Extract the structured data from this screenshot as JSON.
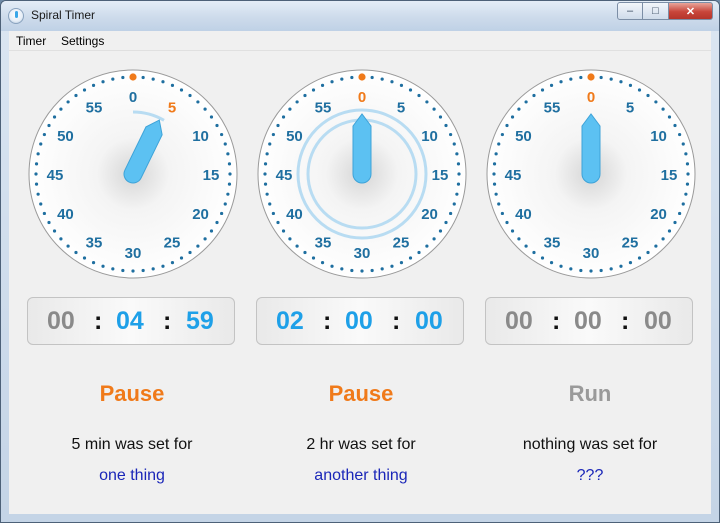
{
  "window": {
    "title": "Spiral Timer",
    "minimize_glyph": "–",
    "maximize_glyph": "□",
    "close_glyph": "✕"
  },
  "menu": {
    "items": [
      "Timer",
      "Settings"
    ]
  },
  "dial_numbers": [
    "0",
    "5",
    "10",
    "15",
    "20",
    "25",
    "30",
    "35",
    "40",
    "45",
    "50",
    "55"
  ],
  "colors": {
    "accent_orange": "#f07a1a",
    "digit_blue": "#1ea0e8",
    "digit_gray": "#8a8a8a",
    "name_blue": "#1a26b8",
    "hand": "#5cc1f2",
    "tick_blue": "#1f6fa0"
  },
  "timers": [
    {
      "remaining": {
        "h": "00",
        "m": "04",
        "s": "59"
      },
      "active": {
        "h": false,
        "m": true,
        "s": true
      },
      "hand_minutes": 5,
      "action": "Pause",
      "action_color": "#f07a1a",
      "description": "5 min was set for",
      "name": "one thing"
    },
    {
      "remaining": {
        "h": "02",
        "m": "00",
        "s": "00"
      },
      "active": {
        "h": true,
        "m": true,
        "s": true
      },
      "hand_minutes": 0,
      "action": "Pause",
      "action_color": "#f07a1a",
      "description": "2 hr was set for",
      "name": "another thing"
    },
    {
      "remaining": {
        "h": "00",
        "m": "00",
        "s": "00"
      },
      "active": {
        "h": false,
        "m": false,
        "s": false
      },
      "hand_minutes": 0,
      "action": "Run",
      "action_color": "#9a9a9a",
      "description": "nothing was set for",
      "name": "???"
    }
  ]
}
